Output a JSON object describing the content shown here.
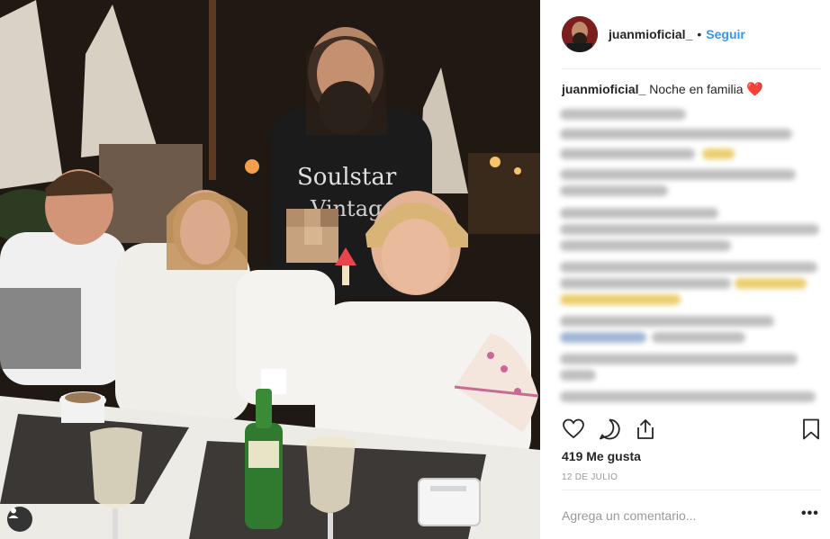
{
  "post": {
    "photo_alt": "Family dinner photo",
    "tag_icon": "user-tag-icon",
    "account": {
      "handle": "juanmioficial_",
      "separator": "•",
      "follow_label": "Seguir"
    },
    "caption": {
      "user": "juanmioficial_",
      "text": "Noche en familia",
      "emoji": "❤️"
    },
    "likes": "419 Me gusta",
    "date": "12 DE JULIO",
    "comment_placeholder": "Agrega un comentario...",
    "more_label": "•••",
    "icons": {
      "like": "heart-icon",
      "comment": "comment-icon",
      "share": "share-icon",
      "save": "bookmark-icon"
    },
    "colors": {
      "link_blue": "#3897f0",
      "text": "#262626",
      "muted": "#999999"
    }
  }
}
